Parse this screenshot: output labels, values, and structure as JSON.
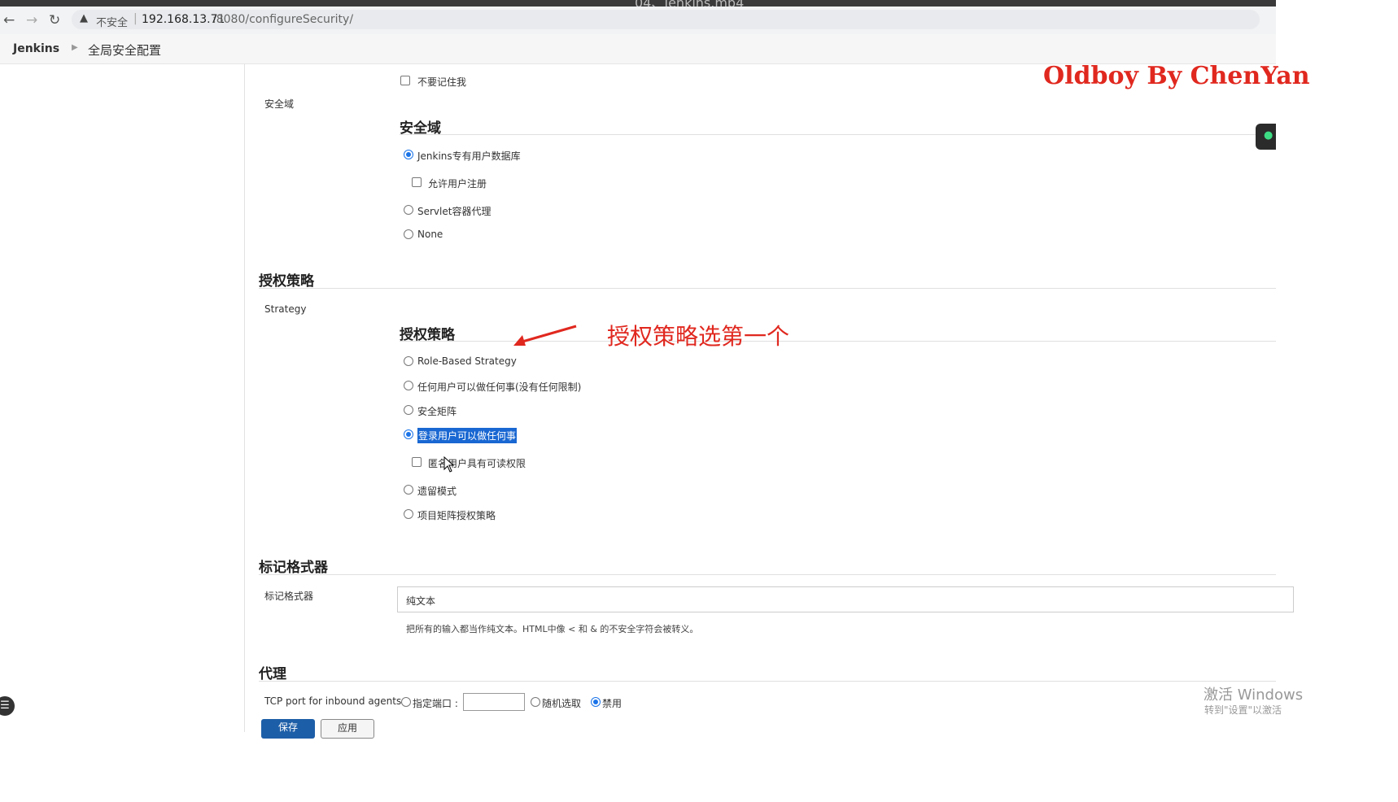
{
  "browser": {
    "window_title": "04、Jenkins.mp4",
    "security_label": "不安全",
    "url_host": "192.168.13.71",
    "url_path": ":8080/configureSecurity/"
  },
  "breadcrumb": {
    "root": "Jenkins",
    "page": "全局安全配置"
  },
  "login": {
    "remember_me_label": "不要记住我"
  },
  "security_realm": {
    "side_label": "安全域",
    "heading": "安全域",
    "options": [
      {
        "label": "Jenkins专有用户数据库",
        "selected": true
      },
      {
        "label": "Servlet容器代理",
        "selected": false
      },
      {
        "label": "None",
        "selected": false
      }
    ],
    "allow_signup_label": "允许用户注册"
  },
  "authorization": {
    "section_title": "授权策略",
    "side_label": "Strategy",
    "heading": "授权策略",
    "options": [
      {
        "label": "Role-Based Strategy",
        "selected": false
      },
      {
        "label": "任何用户可以做任何事(没有任何限制)",
        "selected": false
      },
      {
        "label": "安全矩阵",
        "selected": false
      },
      {
        "label": "登录用户可以做任何事",
        "selected": true
      },
      {
        "label": "遗留模式",
        "selected": false
      },
      {
        "label": "项目矩阵授权策略",
        "selected": false
      }
    ],
    "anonymous_read_label": "匿名用户具有可读权限"
  },
  "markup": {
    "section_title": "标记格式器",
    "side_label": "标记格式器",
    "value": "纯文本",
    "help": "把所有的输入都当作纯文本。HTML中像 < 和 & 的不安全字符会被转义。"
  },
  "proxy": {
    "section_title": "代理",
    "tcp_label": "TCP port for inbound agents",
    "fixed_label": "指定端口 :",
    "random_label": "随机选取",
    "disable_label": "禁用",
    "selected": "禁用"
  },
  "buttons": {
    "save": "保存",
    "apply": "应用"
  },
  "overlays": {
    "watermark": "Oldboy By ChenYan",
    "annotation": "授权策略选第一个",
    "windows_activate": "激活 Windows",
    "windows_activate_sub": "转到\"设置\"以激活"
  },
  "colors": {
    "annotation_red": "#e0281f",
    "radio_blue": "#1a73e8",
    "save_blue": "#1d5ea8"
  }
}
